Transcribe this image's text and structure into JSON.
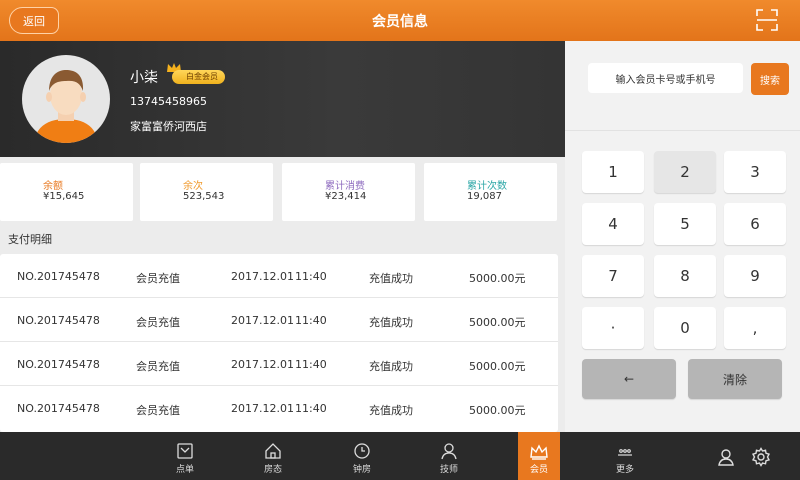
{
  "header": {
    "back_label": "返回",
    "title": "会员信息"
  },
  "member": {
    "name": "小柒",
    "level": "白金会员",
    "phone": "13745458965",
    "store": "家富富侨河西店"
  },
  "stats": [
    {
      "label": "余额",
      "value": "¥15,645",
      "color": "#e8781f"
    },
    {
      "label": "余次",
      "value": "523,543",
      "color": "#f09a2c"
    },
    {
      "label": "累计消费",
      "value": "¥23,414",
      "color": "#8e6bbf"
    },
    {
      "label": "累计次数",
      "value": "19,087",
      "color": "#2aa6a6"
    }
  ],
  "payments": {
    "title": "支付明细",
    "rows": [
      {
        "no": "NO.201745478",
        "type": "会员充值",
        "date": "2017.12.01",
        "time": "11:40",
        "status": "充值成功",
        "amount": "5000.00元"
      },
      {
        "no": "NO.201745478",
        "type": "会员充值",
        "date": "2017.12.01",
        "time": "11:40",
        "status": "充值成功",
        "amount": "5000.00元"
      },
      {
        "no": "NO.201745478",
        "type": "会员充值",
        "date": "2017.12.01",
        "time": "11:40",
        "status": "充值成功",
        "amount": "5000.00元"
      },
      {
        "no": "NO.201745478",
        "type": "会员充值",
        "date": "2017.12.01",
        "time": "11:40",
        "status": "充值成功",
        "amount": "5000.00元"
      }
    ]
  },
  "search": {
    "placeholder": "输入会员卡号或手机号",
    "button": "搜索"
  },
  "keypad": {
    "keys": [
      "1",
      "2",
      "3",
      "4",
      "5",
      "6",
      "7",
      "8",
      "9",
      "·",
      "0",
      ","
    ],
    "backspace": "←",
    "clear": "清除"
  },
  "bottom_nav": [
    {
      "label": "点单",
      "icon": "order-icon"
    },
    {
      "label": "房态",
      "icon": "room-status-icon"
    },
    {
      "label": "钟房",
      "icon": "clock-icon"
    },
    {
      "label": "技师",
      "icon": "technician-icon"
    },
    {
      "label": "会员",
      "icon": "crown-icon",
      "active": true
    },
    {
      "label": "更多",
      "icon": "more-icon"
    }
  ],
  "colors": {
    "accent": "#e8781f",
    "dark_bar": "#2a2a2a"
  }
}
